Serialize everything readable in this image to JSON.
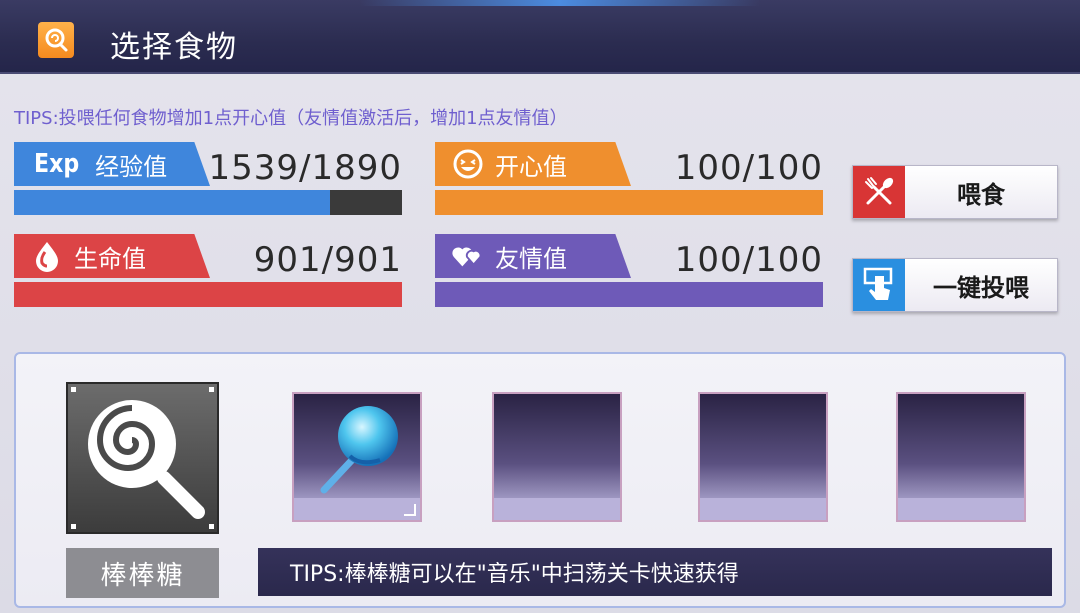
{
  "header": {
    "title": "选择食物",
    "icon": "lollipop-icon"
  },
  "tips_top": "TIPS:投喂任何食物增加1点开心值（友情值激活后，增加1点友情值）",
  "stats": {
    "exp": {
      "label": "经验值",
      "prefix": "Exp",
      "value": "1539/1890",
      "fraction": 0.814,
      "color": "#3f86dc"
    },
    "happy": {
      "label": "开心值",
      "value": "100/100",
      "fraction": 1.0,
      "color": "#ef8f2e",
      "icon": "smile-icon"
    },
    "hp": {
      "label": "生命值",
      "value": "901/901",
      "fraction": 1.0,
      "color": "#dc4446",
      "icon": "blood-drop-icon"
    },
    "friendship": {
      "label": "友情值",
      "value": "100/100",
      "fraction": 1.0,
      "color": "#6e5ab8",
      "icon": "hearts-icon"
    }
  },
  "buttons": {
    "feed": {
      "label": "喂食",
      "icon": "fork-spoon-icon"
    },
    "one_click_feed": {
      "label": "一键投喂",
      "icon": "tap-hand-icon"
    }
  },
  "selected_food": {
    "name": "棒棒糖",
    "icon": "lollipop-icon"
  },
  "food_slots": [
    {
      "item": "blue-lollipop-icon",
      "selected": true
    },
    {
      "item": null
    },
    {
      "item": null
    },
    {
      "item": null
    }
  ],
  "tips_bottom": "TIPS:棒棒糖可以在\"音乐\"中扫荡关卡快速获得"
}
